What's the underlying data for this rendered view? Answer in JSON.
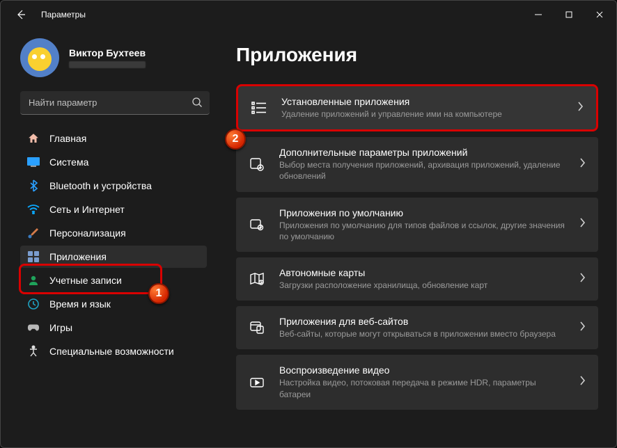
{
  "window": {
    "title": "Параметры"
  },
  "profile": {
    "name": "Виктор Бухтеев"
  },
  "search": {
    "placeholder": "Найти параметр"
  },
  "sidebar": {
    "items": [
      {
        "label": "Главная"
      },
      {
        "label": "Система"
      },
      {
        "label": "Bluetooth и устройства"
      },
      {
        "label": "Сеть и Интернет"
      },
      {
        "label": "Персонализация"
      },
      {
        "label": "Приложения"
      },
      {
        "label": "Учетные записи"
      },
      {
        "label": "Время и язык"
      },
      {
        "label": "Игры"
      },
      {
        "label": "Специальные возможности"
      }
    ]
  },
  "page": {
    "title": "Приложения"
  },
  "cards": [
    {
      "title": "Установленные приложения",
      "sub": "Удаление приложений и управление ими на компьютере"
    },
    {
      "title": "Дополнительные параметры приложений",
      "sub": "Выбор места получения приложений, архивация приложений, удаление обновлений"
    },
    {
      "title": "Приложения по умолчанию",
      "sub": "Приложения по умолчанию для типов файлов и ссылок, другие значения по умолчанию"
    },
    {
      "title": "Автономные карты",
      "sub": "Загрузки расположение хранилища, обновление карт"
    },
    {
      "title": "Приложения для веб-сайтов",
      "sub": "Веб-сайты, которые могут открываться в приложении вместо браузера"
    },
    {
      "title": "Воспроизведение видео",
      "sub": "Настройка видео, потоковая передача в режиме HDR, параметры батареи"
    }
  ],
  "badges": {
    "one": "1",
    "two": "2"
  }
}
